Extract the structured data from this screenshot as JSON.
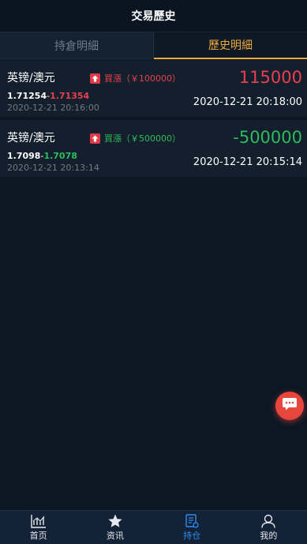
{
  "header": {
    "title": "交易歷史"
  },
  "tabs": [
    {
      "label": "持倉明細",
      "active": false
    },
    {
      "label": "歷史明細",
      "active": true
    }
  ],
  "records": [
    {
      "pair": "英镑/澳元",
      "direction_icon": "up-arrow-icon",
      "direction_label": "買漲（￥100000）",
      "direction_color": "#e8404e",
      "open_price": "1.71254",
      "price_separator": "-",
      "close_price": "1.71354",
      "close_price_color": "#e8404e",
      "open_time": "2020-12-21 20:16:00",
      "profit": "115000",
      "profit_color": "#e8404e",
      "close_time": "2020-12-21 20:18:00"
    },
    {
      "pair": "英镑/澳元",
      "direction_icon": "up-arrow-icon",
      "direction_label": "買漲（￥500000）",
      "direction_color": "#2dbb5c",
      "open_price": "1.7098",
      "price_separator": "-",
      "close_price": "1.7078",
      "close_price_color": "#2dbb5c",
      "open_time": "2020-12-21 20:13:14",
      "profit": "-500000",
      "profit_color": "#2dbb5c",
      "close_time": "2020-12-21 20:15:14"
    }
  ],
  "floating_button": {
    "icon": "chat-bubble-icon",
    "color": "#e8453c"
  },
  "tabbar": [
    {
      "label": "首页",
      "icon": "chart-icon",
      "active": false
    },
    {
      "label": "资讯",
      "icon": "star-icon",
      "active": false
    },
    {
      "label": "持仓",
      "icon": "document-icon",
      "active": true
    },
    {
      "label": "我的",
      "icon": "user-icon",
      "active": false
    }
  ],
  "colors": {
    "background": "#0c1724",
    "card": "#141f2d",
    "accent": "#f0a93b",
    "tabbar_active": "#2d8cf0",
    "rise": "#e8404e",
    "fall": "#2dbb5c"
  }
}
